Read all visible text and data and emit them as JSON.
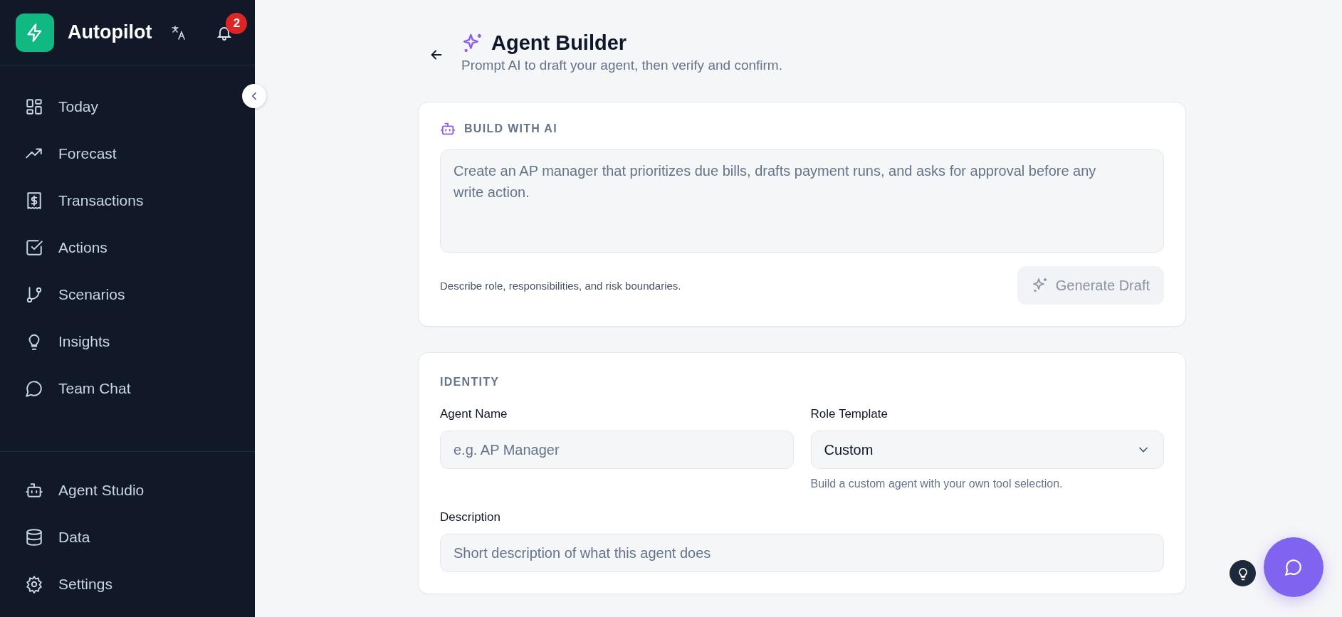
{
  "sidebar": {
    "brand": "Autopilot",
    "notifications": {
      "count": "2"
    },
    "nav_items": [
      {
        "label": "Today"
      },
      {
        "label": "Forecast"
      },
      {
        "label": "Transactions"
      },
      {
        "label": "Actions"
      },
      {
        "label": "Scenarios"
      },
      {
        "label": "Insights"
      },
      {
        "label": "Team Chat"
      }
    ],
    "bottom_items": [
      {
        "label": "Agent Studio"
      },
      {
        "label": "Data"
      },
      {
        "label": "Settings"
      }
    ]
  },
  "header": {
    "title": "Agent Builder",
    "subtitle": "Prompt AI to draft your agent, then verify and confirm."
  },
  "build_card": {
    "heading": "BUILD WITH AI",
    "prompt": {
      "placeholder": "Create an AP manager that prioritizes due bills, drafts payment runs, and asks for approval before any write action."
    },
    "hint": "Describe role, responsibilities, and risk boundaries.",
    "generate_button": {
      "label": "Generate Draft",
      "disabled": true
    }
  },
  "identity_card": {
    "heading": "IDENTITY",
    "agent_name": {
      "label": "Agent Name",
      "placeholder": "e.g. AP Manager"
    },
    "role_template": {
      "label": "Role Template",
      "value": "Custom",
      "help": "Build a custom agent with your own tool selection."
    },
    "description": {
      "label": "Description",
      "placeholder": "Short description of what this agent does"
    }
  }
}
